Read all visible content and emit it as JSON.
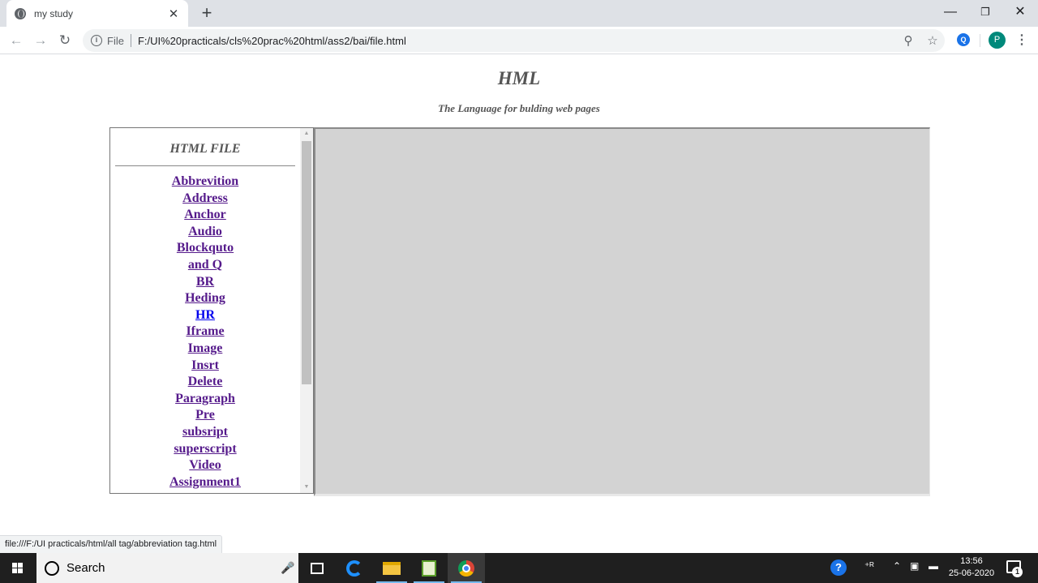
{
  "browser": {
    "tab_title": "my study",
    "tab_close": "✕",
    "new_tab": "+",
    "address_label": "File",
    "address_url": "F:/UI%20practicals/cls%20prac%20html/ass2/bai/file.html",
    "profile_initial": "P",
    "status_url": "file:///F:/UI practicals/html/all tag/abbreviation tag.html"
  },
  "page": {
    "title": "HML",
    "subtitle": "The Language for bulding web pages"
  },
  "left_frame": {
    "heading": "HTML FILE",
    "links": [
      {
        "label": "Abbrevition",
        "visited": true
      },
      {
        "label": "Address",
        "visited": true
      },
      {
        "label": "Anchor",
        "visited": true
      },
      {
        "label": "Audio",
        "visited": true
      },
      {
        "label": "Blockquto",
        "visited": true
      },
      {
        "label": "and Q",
        "visited": true
      },
      {
        "label": "BR",
        "visited": true
      },
      {
        "label": "Heding",
        "visited": true
      },
      {
        "label": "HR",
        "visited": false
      },
      {
        "label": "Iframe",
        "visited": true
      },
      {
        "label": "Image",
        "visited": true
      },
      {
        "label": "Insrt",
        "visited": true
      },
      {
        "label": "Delete",
        "visited": true
      },
      {
        "label": "Paragraph",
        "visited": true
      },
      {
        "label": "Pre",
        "visited": true
      },
      {
        "label": "subsript",
        "visited": true
      },
      {
        "label": "superscript",
        "visited": true
      },
      {
        "label": "Video",
        "visited": true
      },
      {
        "label": "Assignment1",
        "visited": true
      }
    ]
  },
  "taskbar": {
    "search_placeholder": "Search",
    "time": "13:56",
    "date": "25-06-2020",
    "notification_count": "1"
  },
  "colors": {
    "visited_link": "#551a8b",
    "unvisited_link": "#0000ee",
    "right_frame_bg": "#d3d3d3",
    "heading_gray": "#555555"
  }
}
